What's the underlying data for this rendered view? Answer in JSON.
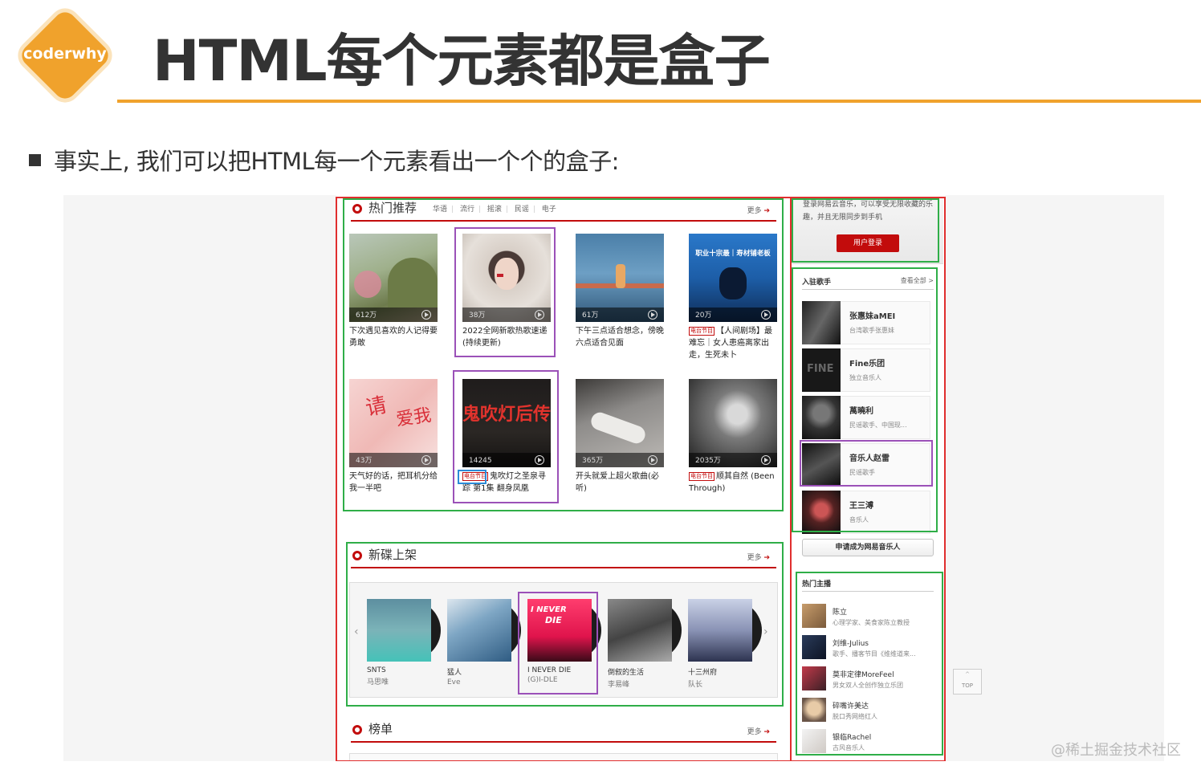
{
  "slide": {
    "logo": "coderwhy",
    "title": "HTML每个元素都是盒子",
    "bullet": "事实上, 我们可以把HTML每一个元素看出一个个的盒子:",
    "watermark": "@稀土掘金技术社区"
  },
  "page": {
    "hot": {
      "title": "热门推荐",
      "tags": [
        "华语",
        "流行",
        "摇滚",
        "民谣",
        "电子"
      ],
      "more": "更多",
      "cards": [
        {
          "count": "612万",
          "title": "下次遇见喜欢的人记得要勇敢",
          "radio": ""
        },
        {
          "count": "38万",
          "title": "2022全网新歌热歌速递(持续更新)",
          "radio": ""
        },
        {
          "count": "61万",
          "title": "下午三点适合想念，傍晚六点适合见面",
          "radio": ""
        },
        {
          "count": "20万",
          "title": "【人间剧场】最难忘｜女人患癌离家出走，生死未卜",
          "radio": "电台节目",
          "cover_text": "职业十宗最｜寿材铺老板"
        },
        {
          "count": "43万",
          "title": "天气好的话，把耳机分给我一半吧",
          "radio": ""
        },
        {
          "count": "14245",
          "title": "鬼吹灯之圣泉寻踪 第1集 翻身凤凰",
          "radio": "电台节目",
          "cover_text": "鬼吹灯后传"
        },
        {
          "count": "365万",
          "title": "开头就爱上超火歌曲(必听)",
          "radio": ""
        },
        {
          "count": "2035万",
          "title": "顺其自然 (Been Through)",
          "radio": "电台节目"
        }
      ]
    },
    "new": {
      "title": "新碟上架",
      "more": "更多",
      "albums": [
        {
          "title": "SNTS",
          "artist": "马思唯"
        },
        {
          "title": "猛人",
          "artist": "Eve"
        },
        {
          "title": "I NEVER DIE",
          "artist": "(G)I-DLE"
        },
        {
          "title": "倒叙的生活",
          "artist": "李易峰"
        },
        {
          "title": "十三州府",
          "artist": "队长"
        }
      ]
    },
    "rank": {
      "title": "榜单",
      "more": "更多"
    },
    "login": {
      "desc": "登录网易云音乐，可以享受无限收藏的乐趣，并且无限同步到手机",
      "button": "用户登录"
    },
    "artists": {
      "title": "入驻歌手",
      "view_all": "查看全部 >",
      "items": [
        {
          "name": "张惠妹aMEI",
          "desc": "台湾歌手张惠妹"
        },
        {
          "name": "Fine乐团",
          "desc": "独立音乐人"
        },
        {
          "name": "萬曉利",
          "desc": "民谣歌手、中国现..."
        },
        {
          "name": "音乐人赵雷",
          "desc": "民谣歌手"
        },
        {
          "name": "王三溥",
          "desc": "音乐人"
        }
      ],
      "apply": "申请成为网易音乐人"
    },
    "djs": {
      "title": "热门主播",
      "items": [
        {
          "name": "陈立",
          "desc": "心理学家、美食家陈立教授"
        },
        {
          "name": "刘维-Julius",
          "desc": "歌手、播客节目《维维道来..."
        },
        {
          "name": "莫非定律MoreFeel",
          "desc": "男女双人全创作独立乐团"
        },
        {
          "name": "碎嘴许美达",
          "desc": "脱口秀网络红人"
        },
        {
          "name": "银临Rachel",
          "desc": "古风音乐人"
        }
      ]
    },
    "top_button": "TOP",
    "colors": {
      "accent_orange": "#f0a22c",
      "netease_red": "#c20c0c",
      "box_red": "#e02e2e",
      "box_green": "#2fae48",
      "box_purple": "#9b51b8"
    }
  }
}
